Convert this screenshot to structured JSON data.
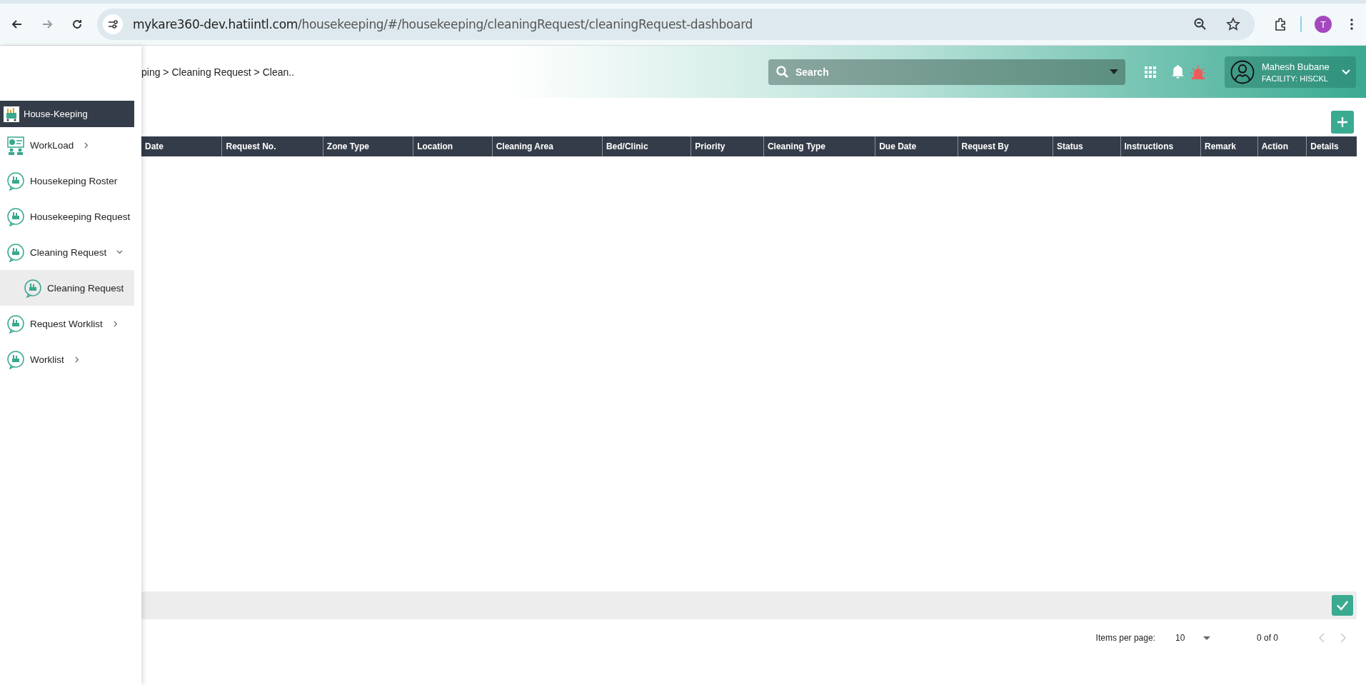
{
  "browser": {
    "url_host": "mykare360-dev.hatiintl.com",
    "url_path": "/housekeeping/#/housekeeping/cleaningRequest/cleaningRequest-dashboard",
    "profile_initial": "T"
  },
  "header": {
    "breadcrumb": "ping > Cleaning Request > Clean..",
    "search": {
      "placeholder": "Search"
    },
    "user": {
      "name": "Mahesh Bubane",
      "facility": "FACILITY: HISCKL"
    }
  },
  "sidebar": {
    "title": "House-Keeping",
    "items": [
      {
        "label": "WorkLoad",
        "kind": "group",
        "expanded": false,
        "selected": false
      },
      {
        "label": "Housekeping Roster",
        "kind": "link",
        "selected": false
      },
      {
        "label": "Housekeeping Request",
        "kind": "link",
        "selected": false
      },
      {
        "label": "Cleaning Request",
        "kind": "group",
        "expanded": true,
        "selected": false,
        "children": [
          {
            "label": "Cleaning Request",
            "selected": true
          }
        ]
      },
      {
        "label": "Request Worklist",
        "kind": "group",
        "expanded": false,
        "selected": false
      },
      {
        "label": "Worklist",
        "kind": "group",
        "expanded": false,
        "selected": false
      }
    ]
  },
  "table": {
    "columns": [
      "Date",
      "Request No.",
      "Zone Type",
      "Location",
      "Cleaning Area",
      "Bed/Clinic",
      "Priority",
      "Cleaning Type",
      "Due Date",
      "Request By",
      "Status",
      "Instructions",
      "Remark",
      "Action",
      "Details"
    ]
  },
  "paginator": {
    "items_per_page_label": "Items per page:",
    "page_size": "10",
    "range": "0 of 0",
    "prev_disabled": true,
    "next_disabled": true
  }
}
